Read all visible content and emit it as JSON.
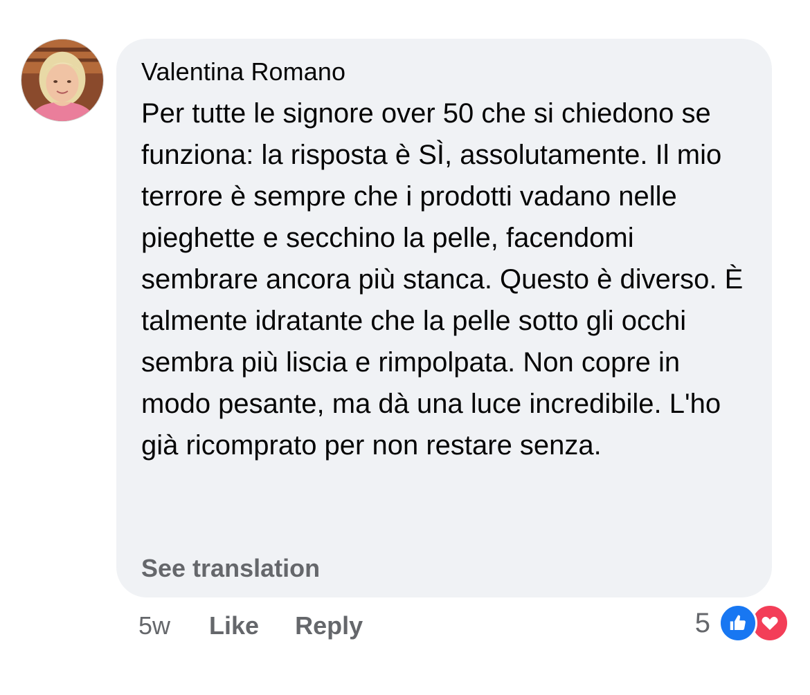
{
  "comment": {
    "author": "Valentina Romano",
    "text": "Per tutte le signore over 50 che si chiedono se funziona: la risposta è SÌ, assolutamente. Il mio terrore è sempre che i prodotti vadano nelle pieghette e secchino la pelle, facendomi sembrare ancora più stanca. Questo è diverso. È talmente idratante che la pelle sotto gli occhi sembra più liscia e rimpolpata. Non copre in modo pesante, ma dà una luce incredibile. L'ho già ricomprato per non restare senza.",
    "see_translation": "See translation"
  },
  "actions": {
    "time": "5w",
    "like": "Like",
    "reply": "Reply"
  },
  "reactions": {
    "count": "5",
    "icons": [
      "like-icon",
      "love-icon"
    ]
  },
  "colors": {
    "bubble": "#f0f2f5",
    "secondary_text": "#65676b",
    "like_blue": "#1877f2",
    "love_red": "#f33e58"
  }
}
